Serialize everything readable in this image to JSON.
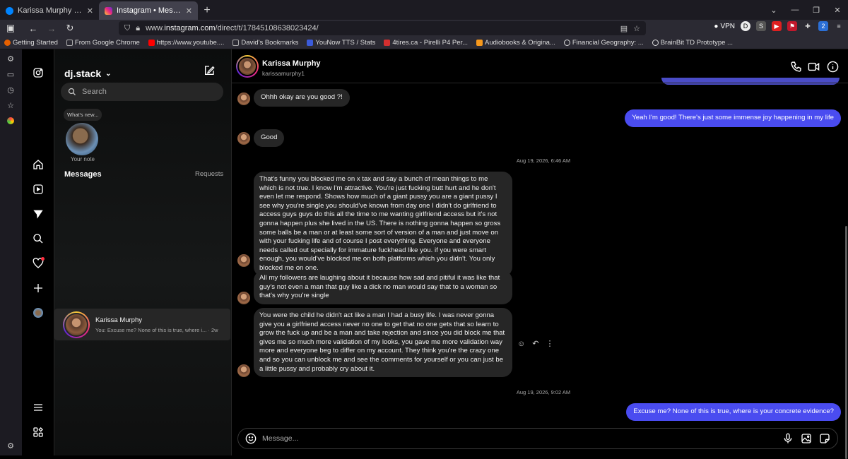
{
  "browser": {
    "tabs": [
      {
        "label": "Karissa Murphy | Messenger",
        "color": "#0084ff"
      },
      {
        "label": "Instagram • Messages",
        "color": "#e1306c"
      }
    ],
    "url_prefix": "www.",
    "url_domain": "instagram.com",
    "url_path": "/direct/t/17845108638023424/",
    "vpn_label": "VPN",
    "bookmarks": [
      {
        "label": "Getting Started",
        "color": "#e66000"
      },
      {
        "label": "From Google Chrome",
        "color": "#aaaaaa"
      },
      {
        "label": "https://www.youtube....",
        "color": "#ff0000"
      },
      {
        "label": "David's Bookmarks",
        "color": "#aaaaaa"
      },
      {
        "label": "YouNow TTS / Stats",
        "color": "#3b5bdb"
      },
      {
        "label": "4tires.ca - Pirelli P4 Per...",
        "color": "#d32f2f"
      },
      {
        "label": "Audiobooks & Origina...",
        "color": "#f7991c"
      },
      {
        "label": "Financial Geography: ...",
        "color": "#dddddd"
      },
      {
        "label": "BrainBit TD Prototype ...",
        "color": "#dddddd"
      }
    ],
    "ext_badge": "2"
  },
  "inbox": {
    "username": "dj.stack",
    "search_placeholder": "Search",
    "note_text": "What's new...",
    "note_label": "Your note",
    "messages_label": "Messages",
    "requests_label": "Requests",
    "conversations": [
      {
        "name": "Karissa Murphy",
        "preview": "You: Excuse me? None of this is true, where i... · 2w"
      }
    ]
  },
  "chat": {
    "name": "Karissa Murphy",
    "username": "karissamurphy1",
    "messages": [
      {
        "from": "them",
        "text": "Ohhh okay are you good ?!"
      },
      {
        "from": "me",
        "text": "Yeah I'm good! There's just some immense joy happening in my life"
      },
      {
        "from": "them",
        "text": "Good"
      },
      {
        "type": "timestamp",
        "text": "Aug 19, 2026, 6:46 AM"
      },
      {
        "from": "them",
        "text": "That's funny you blocked me on x tax and say a bunch of mean things to me which is not true. I know I'm attractive. You're just fucking butt hurt and he don't even let me respond. Shows how much of a giant pussy you are a giant pussy I see why you're single you should've known from day one I didn't do girlfriend to access guys guys do this all the time to me wanting girlfriend access but it's not gonna happen plus she lived in the US. There is nothing gonna happen so gross some balls be a man or at least some sort of version of a man and just move on with your fucking life and of course I post everything. Everyone and everyone needs called out specially for immature fuckhead like you. if you were smart enough, you would've blocked me on both platforms which you didn't. You only blocked me on one."
      },
      {
        "from": "them",
        "text": "All my followers are laughing about it because how sad and pitiful it was like that guy's not even a man that guy like a dick no man would say that to a woman so that's why you're single"
      },
      {
        "from": "them",
        "text": "You were the child he didn't act like a man I had a busy life. I was never gonna give you a girlfriend access never no one to get that no one gets that so learn to grow the fuck up and be a man and take rejection and since you did block me that gives me so much more validation of my looks, you gave me more validation way more and everyone beg to differ on my account. They think you're the crazy one and so you can unblock me and see the comments for yourself or you can just be a little pussy and probably cry about it."
      },
      {
        "type": "timestamp",
        "text": "Aug 19, 2026, 9:02 AM"
      },
      {
        "from": "me",
        "text": "Excuse me? None of this is true, where is your concrete evidence?"
      }
    ],
    "composer_placeholder": "Message..."
  },
  "colors": {
    "my_bubble": "#4a4cf0",
    "their_bubble": "#262626",
    "background": "#000000"
  }
}
